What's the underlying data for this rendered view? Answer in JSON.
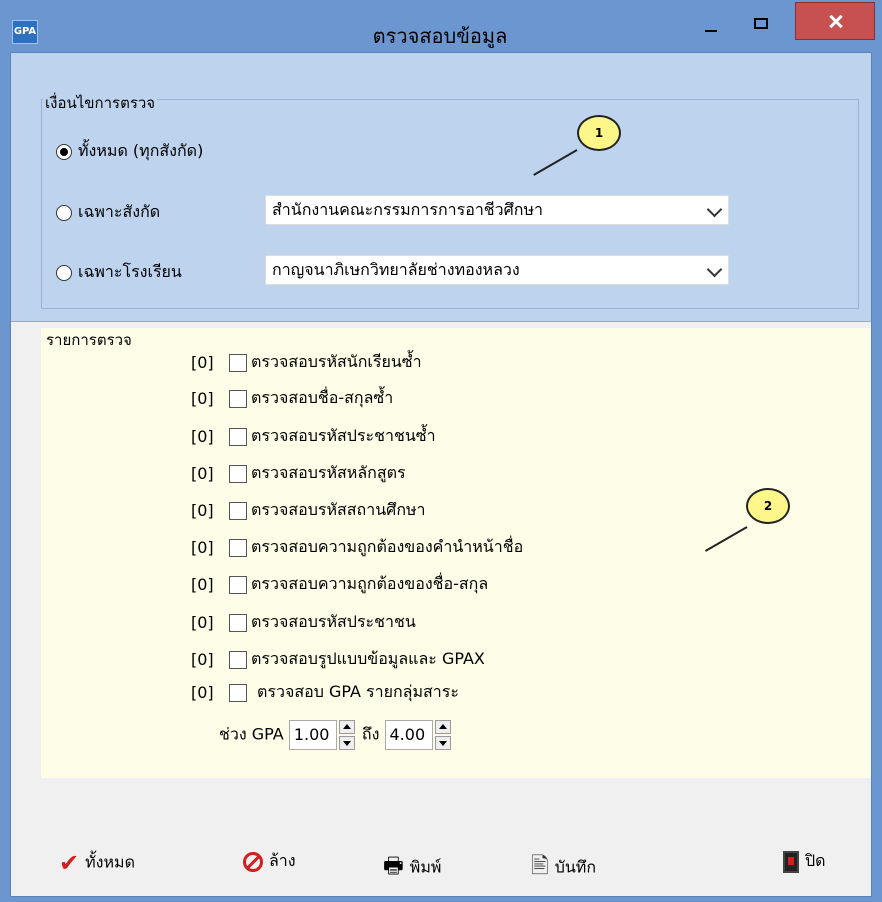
{
  "window": {
    "icon_text": "GPA",
    "title": "ตรวจสอบข้อมูล"
  },
  "conditions": {
    "group_label": "เงื่อนไขการตรวจ",
    "option_all": "ทั้งหมด (ทุกสังกัด)",
    "option_affiliation": "เฉพาะสังกัด",
    "option_school": "เฉพาะโรงเรียน",
    "affiliation_value": "สำนักงานคณะกรรมการการอาชีวศึกษา",
    "school_value": "กาญจนาภิเษกวิทยาลัยช่างทองหลวง",
    "selected": "option_all"
  },
  "checks": {
    "group_label": "รายการตรวจ",
    "items": [
      {
        "count": "[0]",
        "label": "ตรวจสอบรหัสนักเรียนซ้ำ",
        "checked": false
      },
      {
        "count": "[0]",
        "label": "ตรวจสอบชื่อ-สกุลซ้ำ",
        "checked": false
      },
      {
        "count": "[0]",
        "label": "ตรวจสอบรหัสประชาชนซ้ำ",
        "checked": false
      },
      {
        "count": "[0]",
        "label": "ตรวจสอบรหัสหลักสูตร",
        "checked": false
      },
      {
        "count": "[0]",
        "label": "ตรวจสอบรหัสสถานศึกษา",
        "checked": false
      },
      {
        "count": "[0]",
        "label": "ตรวจสอบความถูกต้องของคำนำหน้าชื่อ",
        "checked": false
      },
      {
        "count": "[0]",
        "label": "ตรวจสอบความถูกต้องของชื่อ-สกุล",
        "checked": false
      },
      {
        "count": "[0]",
        "label": "ตรวจสอบรหัสประชาชน",
        "checked": false
      },
      {
        "count": "[0]",
        "label": "ตรวจสอบรูปแบบข้อมูลและ GPAX",
        "checked": false
      },
      {
        "count": "[0]",
        "label": "ตรวจสอบ GPA รายกลุ่มสาระ",
        "checked": false
      }
    ],
    "gpa_range_label": "ช่วง GPA",
    "gpa_from": "1.00",
    "to_label": "ถึง",
    "gpa_to": "4.00"
  },
  "callouts": {
    "one": "1",
    "two": "2"
  },
  "toolbar": {
    "select_all": "ทั้งหมด",
    "clear": "ล้าง",
    "print": "พิมพ์",
    "save": "บันทึก",
    "close": "ปิด"
  },
  "colors": {
    "title_bar": "#6b96d0",
    "conditions_bg": "#bdd3ee",
    "checks_bg": "#fdfde8",
    "close_button": "#c75050",
    "callout": "#fdf78a"
  }
}
